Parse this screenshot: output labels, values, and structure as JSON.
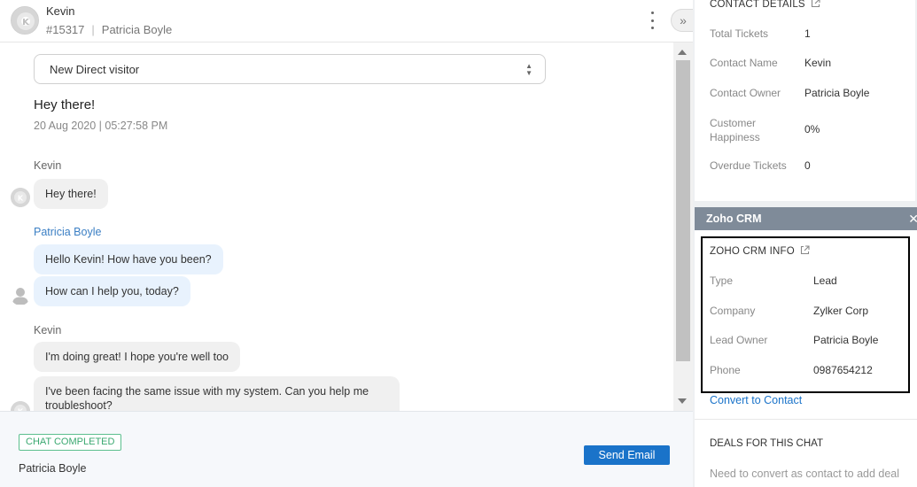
{
  "header": {
    "contact_name": "Kevin",
    "ticket_id": "#15317",
    "assignee": "Patricia Boyle"
  },
  "chat": {
    "visitor_select": "New Direct visitor",
    "greeting": "Hey there!",
    "greeting_time": "20 Aug 2020 | 05:27:58 PM",
    "groups": [
      {
        "sender": "Kevin",
        "messages": [
          "Hey there!"
        ]
      },
      {
        "sender": "Patricia Boyle",
        "messages": [
          "Hello Kevin! How have you been?",
          "How can I help you, today?"
        ]
      },
      {
        "sender": "Kevin",
        "messages": [
          "I'm doing great! I hope you're well too",
          "I've been facing the same issue with my system. Can you help me troubleshoot?"
        ]
      }
    ]
  },
  "footer": {
    "status": "CHAT COMPLETED",
    "agent": "Patricia Boyle",
    "send_email": "Send Email"
  },
  "contact_details": {
    "title": "CONTACT DETAILS",
    "rows": [
      {
        "label": "Total Tickets",
        "value": "1"
      },
      {
        "label": "Contact Name",
        "value": "Kevin"
      },
      {
        "label": "Contact Owner",
        "value": "Patricia Boyle"
      },
      {
        "label": "Customer Happiness",
        "value": "0%"
      },
      {
        "label": "Overdue Tickets",
        "value": "0"
      }
    ]
  },
  "crm": {
    "bar_title": "Zoho CRM",
    "info_title": "ZOHO CRM INFO",
    "rows": [
      {
        "label": "Type",
        "value": "Lead"
      },
      {
        "label": "Company",
        "value": "Zylker Corp"
      },
      {
        "label": "Lead Owner",
        "value": "Patricia Boyle"
      },
      {
        "label": "Phone",
        "value": "0987654212"
      }
    ],
    "convert_link": "Convert to Contact",
    "deals_title": "DEALS FOR THIS CHAT",
    "deals_note": "Need to convert as contact to add deal"
  },
  "colors": {
    "accent": "#1a73c9",
    "agent_name": "#3b7fc4",
    "status_green": "#3aa870",
    "crm_bar": "#7f8b99"
  }
}
